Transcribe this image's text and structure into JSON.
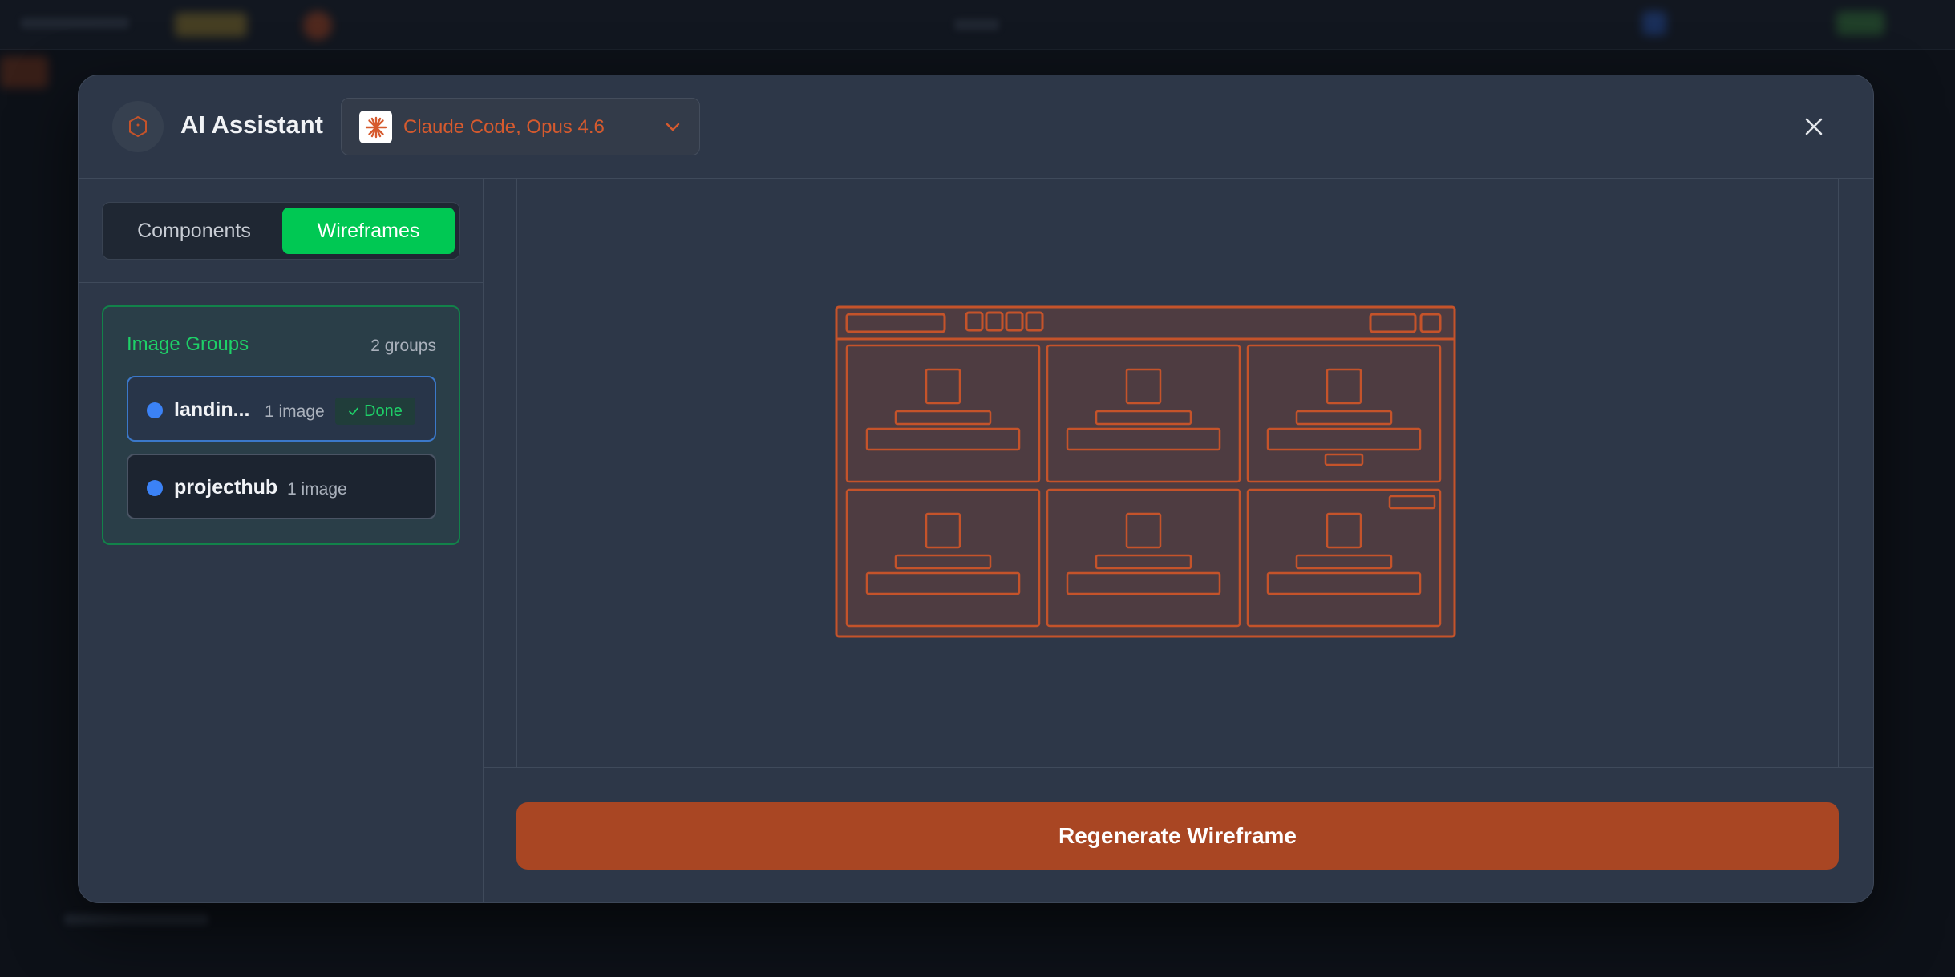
{
  "header": {
    "title": "AI Assistant",
    "model_label": "Claude Code, Opus 4.6",
    "logo_icon": "hexagon-logo-icon",
    "model_icon": "claude-starburst-icon",
    "close_icon": "close-icon"
  },
  "sidebar": {
    "tabs": [
      {
        "label": "Components",
        "active": false
      },
      {
        "label": "Wireframes",
        "active": true
      }
    ],
    "groups_panel": {
      "title": "Image Groups",
      "count": "2 groups",
      "items": [
        {
          "name": "landin...",
          "count": "1 image",
          "status": "Done",
          "selected": true
        },
        {
          "name": "projecthub",
          "count": "1 image",
          "status": "",
          "selected": false
        }
      ]
    }
  },
  "main": {
    "wireframe_icon": "wireframe-preview",
    "regenerate_label": "Regenerate Wireframe"
  },
  "colors": {
    "accent_green": "#00c853",
    "accent_orange": "#a94623",
    "wire_stroke": "#c5532a",
    "dot_blue": "#3b82f6"
  }
}
